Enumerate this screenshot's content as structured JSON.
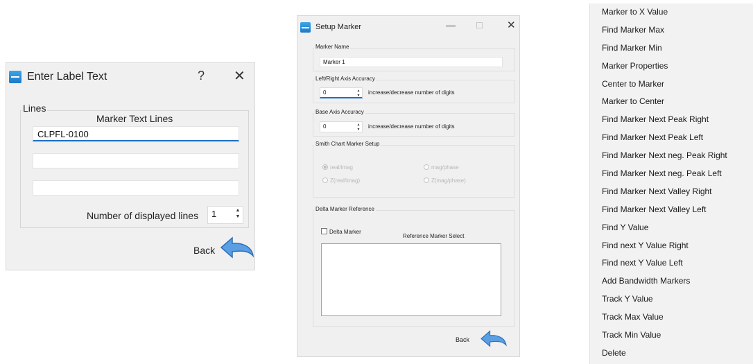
{
  "label_dialog": {
    "title": "Enter Label Text",
    "help_glyph": "?",
    "close_glyph": "✕",
    "group_label": "Lines",
    "column_header": "Marker Text Lines",
    "lines": [
      "CLPFL-0100",
      "",
      ""
    ],
    "num_lines_label": "Number of displayed lines",
    "num_lines_value": "1",
    "back_label": "Back"
  },
  "setup_dialog": {
    "title": "Setup Marker",
    "minimize_glyph": "—",
    "close_glyph": "✕",
    "marker_name_label": "Marker Name",
    "marker_name_value": "Marker 1",
    "lr_accuracy_label": "Left/Right Axis Accuracy",
    "lr_accuracy_value": "0",
    "lr_accuracy_hint": "increase/decrease number of digits",
    "base_accuracy_label": "Base Axis Accuracy",
    "base_accuracy_value": "0",
    "base_accuracy_hint": "increase/decrease number of digits",
    "smith_label": "Smith Chart Marker Setup",
    "smith_options": [
      "real/imag",
      "mag/phase",
      "Z(real/imag)",
      "Z(mag/phase)"
    ],
    "delta_group_label": "Delta Marker Reference",
    "delta_check_label": "Delta Marker",
    "reference_select_label": "Reference Marker Select",
    "back_label": "Back"
  },
  "context_menu": {
    "items": [
      "Marker to X Value",
      "Find Marker Max",
      "Find Marker Min",
      "Marker Properties",
      "Center to Marker",
      "Marker to Center",
      "Find Marker Next Peak Right",
      "Find Marker Next Peak Left",
      "Find Marker Next neg. Peak Right",
      "Find Marker Next neg. Peak Left",
      "Find Marker Next Valley Right",
      "Find Marker Next Valley Left",
      "Find Y Value",
      "Find next Y Value Right",
      "Find next Y Value Left",
      "Add Bandwidth Markers",
      "Track Y Value",
      "Track Max Value",
      "Track Min Value",
      "Delete"
    ]
  },
  "colors": {
    "accent": "#1c6fc4",
    "dialog_bg": "#f0f0f0",
    "back_arrow": "#4a90d9"
  }
}
